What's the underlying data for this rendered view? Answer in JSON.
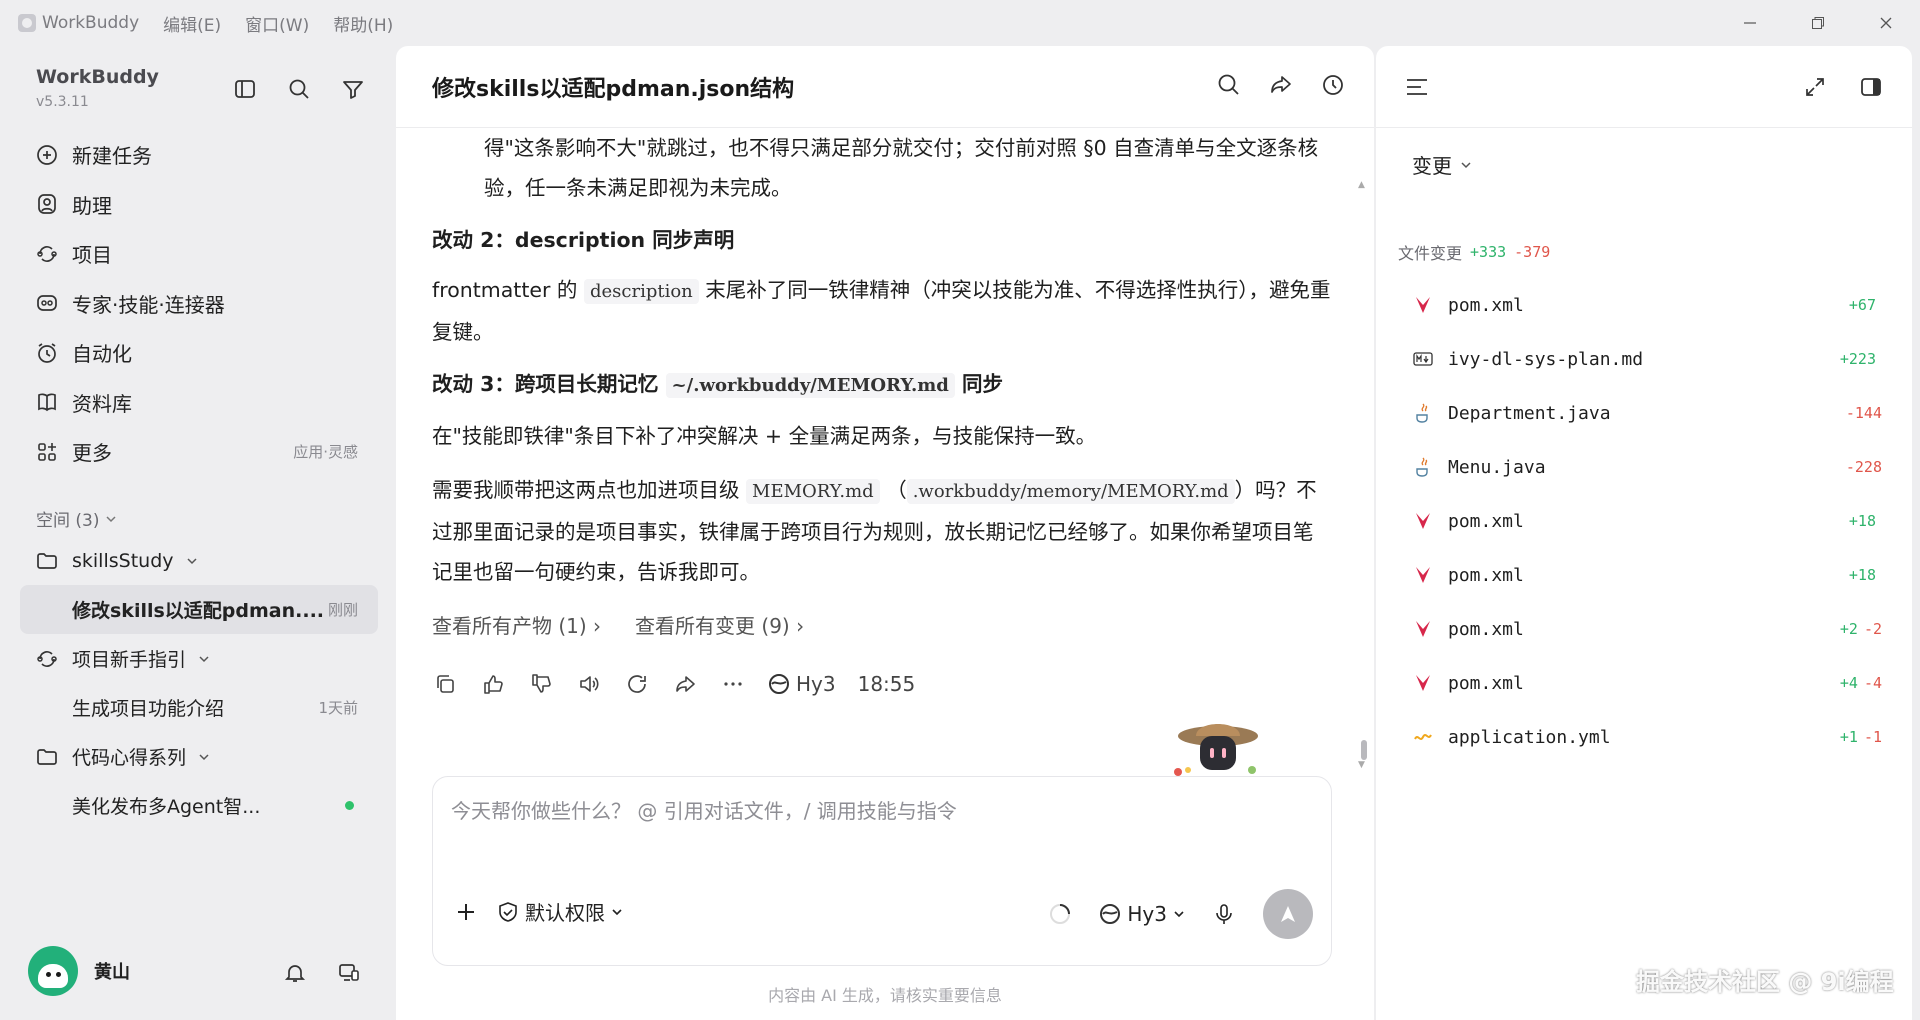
{
  "titlebar": {
    "app_name": "WorkBuddy",
    "menus": [
      "编辑(E)",
      "窗口(W)",
      "帮助(H)"
    ]
  },
  "sidebar": {
    "brand": "WorkBuddy",
    "version": "v5.3.11",
    "nav": [
      {
        "label": "新建任务",
        "icon": "plus-circle-icon"
      },
      {
        "label": "助理",
        "icon": "assistant-icon"
      },
      {
        "label": "项目",
        "icon": "project-icon"
      },
      {
        "label": "专家·技能·连接器",
        "icon": "expert-icon"
      },
      {
        "label": "自动化",
        "icon": "alarm-icon"
      },
      {
        "label": "资料库",
        "icon": "book-icon"
      },
      {
        "label": "更多",
        "icon": "apps-icon",
        "hint": "应用·灵感"
      }
    ],
    "space_label": "空间 (3)",
    "tree": [
      {
        "type": "folder",
        "label": "skillsStudy"
      },
      {
        "type": "task",
        "label": "修改skills以适配pdman....",
        "meta": "刚刚",
        "active": true
      },
      {
        "type": "project",
        "label": "项目新手指引"
      },
      {
        "type": "task",
        "label": "生成项目功能介绍",
        "meta": "1天前"
      },
      {
        "type": "folder",
        "label": "代码心得系列"
      },
      {
        "type": "task",
        "label": "美化发布多Agent智...",
        "status": "online"
      }
    ],
    "user_name": "黄山"
  },
  "main": {
    "title": "修改skills以适配pdman.json结构",
    "paragraphs": {
      "p1": "得\"这条影响不大\"就跳过，也不得只满足部分就交付；交付前对照 §0 自查清单与全文逐条核验，任一条未满足即视为未完成。",
      "h2": "改动 2：description 同步声明",
      "p2a": "frontmatter 的",
      "p2code": "description",
      "p2b": "末尾补了同一铁律精神（冲突以技能为准、不得选择性执行），避免重复键。",
      "h3a": "改动 3：跨项目长期记忆",
      "h3code": "~/.workbuddy/MEMORY.md",
      "h3b": "同步",
      "p3": "在\"技能即铁律\"条目下补了冲突解决 + 全量满足两条，与技能保持一致。",
      "p4a": "需要我顺带把这两点也加进项目级",
      "p4code1": "MEMORY.md",
      "p4mid": "（",
      "p4code2": ".workbuddy/memory/MEMORY.md",
      "p4b": "）吗？不过那里面记录的是项目事实，铁律属于跨项目行为规则，放长期记忆已经够了。如果你希望项目笔记里也留一句硬约束，告诉我即可。"
    },
    "links": [
      "查看所有产物 (1)",
      "查看所有变更 (9)"
    ],
    "model": "Hy3",
    "time": "18:55",
    "composer_placeholder": "今天帮你做些什么？ @ 引用对话文件，/ 调用技能与指令",
    "permission": "默认权限",
    "composer_model": "Hy3",
    "disclaimer": "内容由 AI 生成，请核实重要信息"
  },
  "right": {
    "dropdown": "变更",
    "files_label": "文件变更",
    "total_add": "+333",
    "total_del": "-379",
    "files": [
      {
        "name": "pom.xml",
        "icon": "maven-icon",
        "add": "+67",
        "del": ""
      },
      {
        "name": "ivy-dl-sys-plan.md",
        "icon": "markdown-icon",
        "add": "+223",
        "del": ""
      },
      {
        "name": "Department.java",
        "icon": "java-icon",
        "add": "",
        "del": "-144"
      },
      {
        "name": "Menu.java",
        "icon": "java-icon",
        "add": "",
        "del": "-228"
      },
      {
        "name": "pom.xml",
        "icon": "maven-icon",
        "add": "+18",
        "del": ""
      },
      {
        "name": "pom.xml",
        "icon": "maven-icon",
        "add": "+18",
        "del": ""
      },
      {
        "name": "pom.xml",
        "icon": "maven-icon",
        "add": "+2",
        "del": "-2"
      },
      {
        "name": "pom.xml",
        "icon": "maven-icon",
        "add": "+4",
        "del": "-4"
      },
      {
        "name": "application.yml",
        "icon": "yaml-icon",
        "add": "+1",
        "del": "-1"
      }
    ]
  },
  "watermark": "掘金技术社区 @ 9i编程",
  "colors": {
    "add": "#2fb36b",
    "del": "#e0564b",
    "maven": "#d7274b",
    "active_bg": "#e1e1e5"
  }
}
